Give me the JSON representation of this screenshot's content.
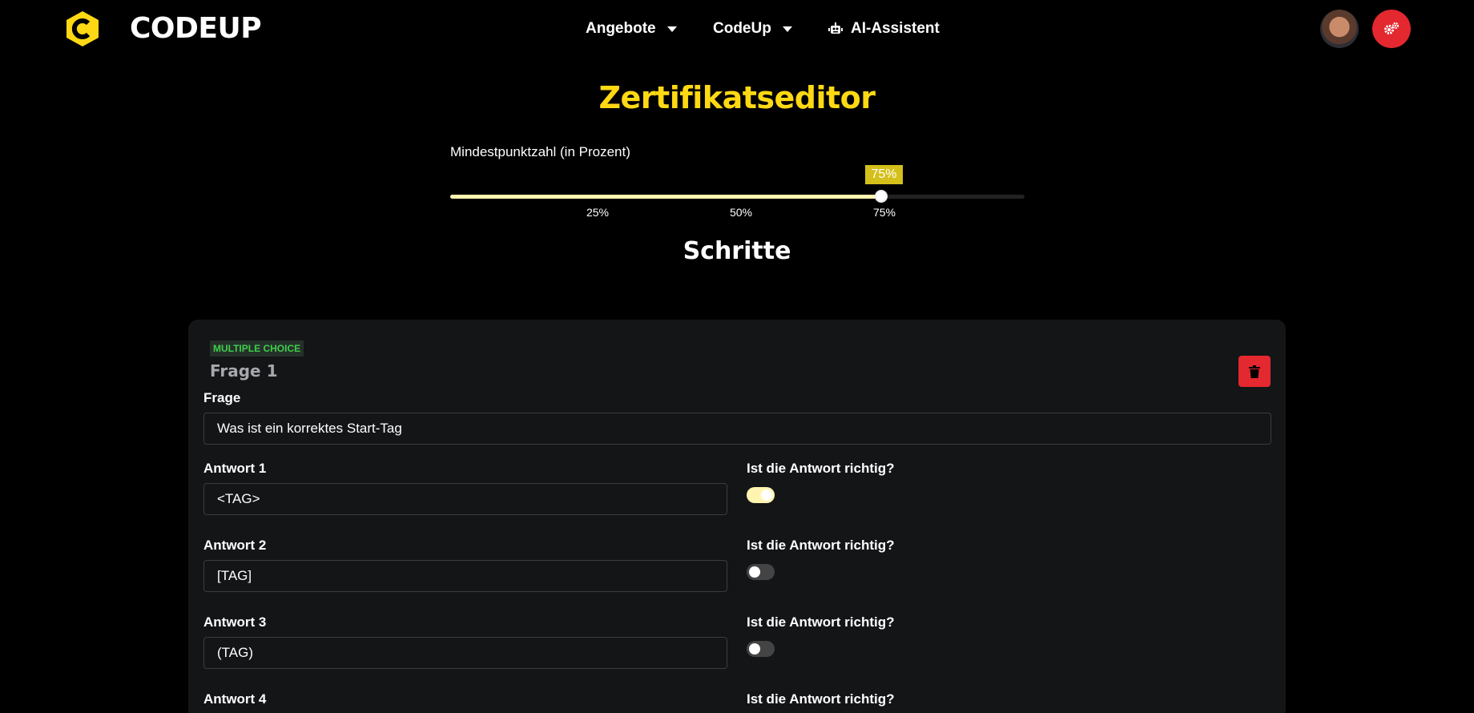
{
  "nav": {
    "brand": "CODEUP",
    "items": [
      {
        "label": "Angebote",
        "has_caret": true
      },
      {
        "label": "CodeUp",
        "has_caret": true
      },
      {
        "label": "AI-Assistent",
        "icon": "robot-icon"
      }
    ],
    "admin_icon": "gears-icon"
  },
  "page": {
    "title": "Zertifikatseditor",
    "slider_label": "Mindestpunktzahl (in Prozent)",
    "slider_value_text": "75%",
    "slider_value": 0.75,
    "ticks": [
      "25%",
      "50%",
      "75%"
    ],
    "section_title": "Schritte"
  },
  "question": {
    "badge": "MULTIPLE CHOICE",
    "title": "Frage 1",
    "question_label": "Frage",
    "question_value": "Was ist ein korrektes Start-Tag",
    "answers": [
      {
        "label": "Antwort 1",
        "value": "<TAG>",
        "correct_label": "Ist die Antwort richtig?",
        "correct": true
      },
      {
        "label": "Antwort 2",
        "value": "[TAG]",
        "correct_label": "Ist die Antwort richtig?",
        "correct": false
      },
      {
        "label": "Antwort 3",
        "value": "(TAG)",
        "correct_label": "Ist die Antwort richtig?",
        "correct": false
      },
      {
        "label": "Antwort 4",
        "value": "",
        "correct_label": "Ist die Antwort richtig?",
        "correct": false
      }
    ]
  },
  "colors": {
    "accent": "#ffd814",
    "danger": "#e3282f",
    "badge_text": "#3fcf4a"
  }
}
